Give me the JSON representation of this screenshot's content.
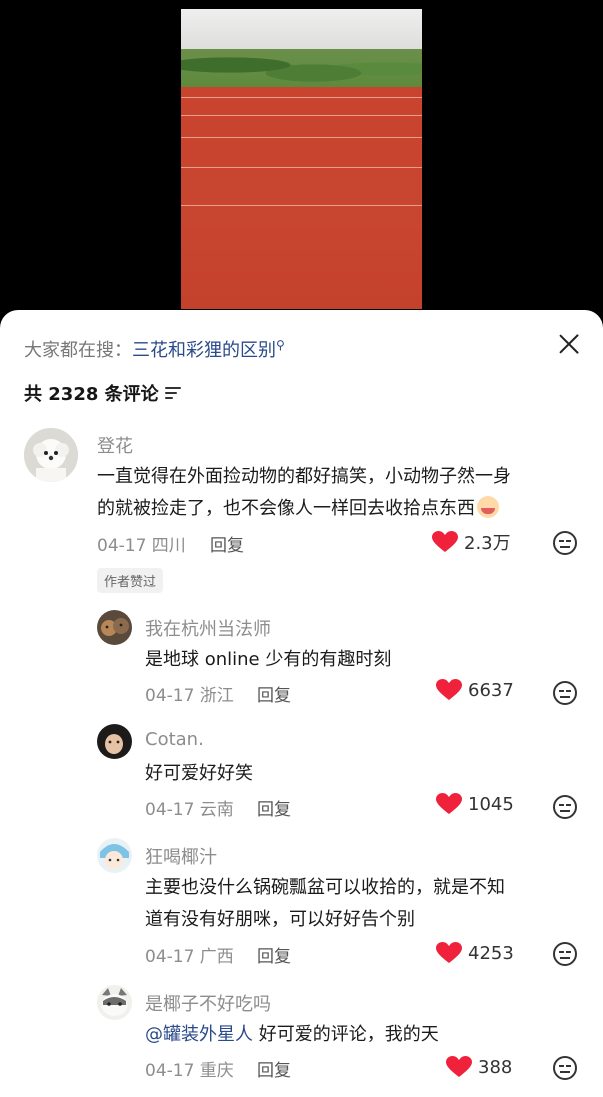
{
  "search_bar": {
    "prefix": "大家都在搜：",
    "query": "三花和彩狸的区别"
  },
  "comments_header": {
    "count_text": "共 2328 条评论"
  },
  "comments": [
    {
      "name": "登花",
      "text_line1": "一直觉得在外面捡动物的都好搞笑，小动物子然一身",
      "text_line2": "的就被捡走了，也不会像人一样回去收拾点东西",
      "date_location": "04-17 四川",
      "reply_label": "回复",
      "likes": "2.3万",
      "author_tag": "作者赞过"
    },
    {
      "name": "我在杭州当法师",
      "text": "是地球 online 少有的有趣时刻",
      "date_location": "04-17 浙江",
      "reply_label": "回复",
      "likes": "6637"
    },
    {
      "name": "Cotan.",
      "text": "好可爱好好笑",
      "date_location": "04-17 云南",
      "reply_label": "回复",
      "likes": "1045"
    },
    {
      "name": "狂喝椰汁",
      "text_line1": "主要也没什么锅碗瓢盆可以收拾的，就是不知",
      "text_line2": "道有没有好朋咪，可以好好告个别",
      "date_location": "04-17 广西",
      "reply_label": "回复",
      "likes": "4253"
    },
    {
      "name": "是椰子不好吃吗",
      "mention": "@罐装外星人",
      "text": " 好可爱的评论，我的天",
      "date_location": "04-17 重庆",
      "reply_label": "回复",
      "likes": "388"
    }
  ],
  "colors": {
    "heart": "#f0213b",
    "link": "#2b4a8b",
    "track": "#c8452f"
  }
}
